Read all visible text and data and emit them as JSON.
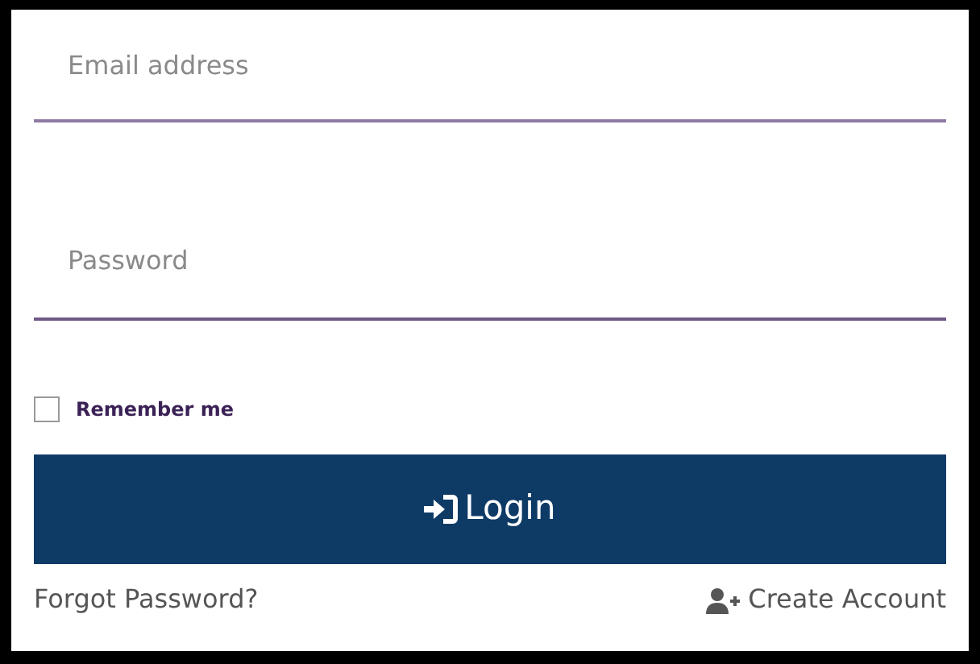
{
  "email": {
    "placeholder": "Email address"
  },
  "password": {
    "placeholder": "Password"
  },
  "remember": {
    "label": "Remember me",
    "checked": false
  },
  "login_button": {
    "label": "Login"
  },
  "links": [
    {
      "kind": "forgot",
      "label": "Forgot Password?"
    },
    {
      "kind": "create",
      "label": "Create Account"
    }
  ]
}
